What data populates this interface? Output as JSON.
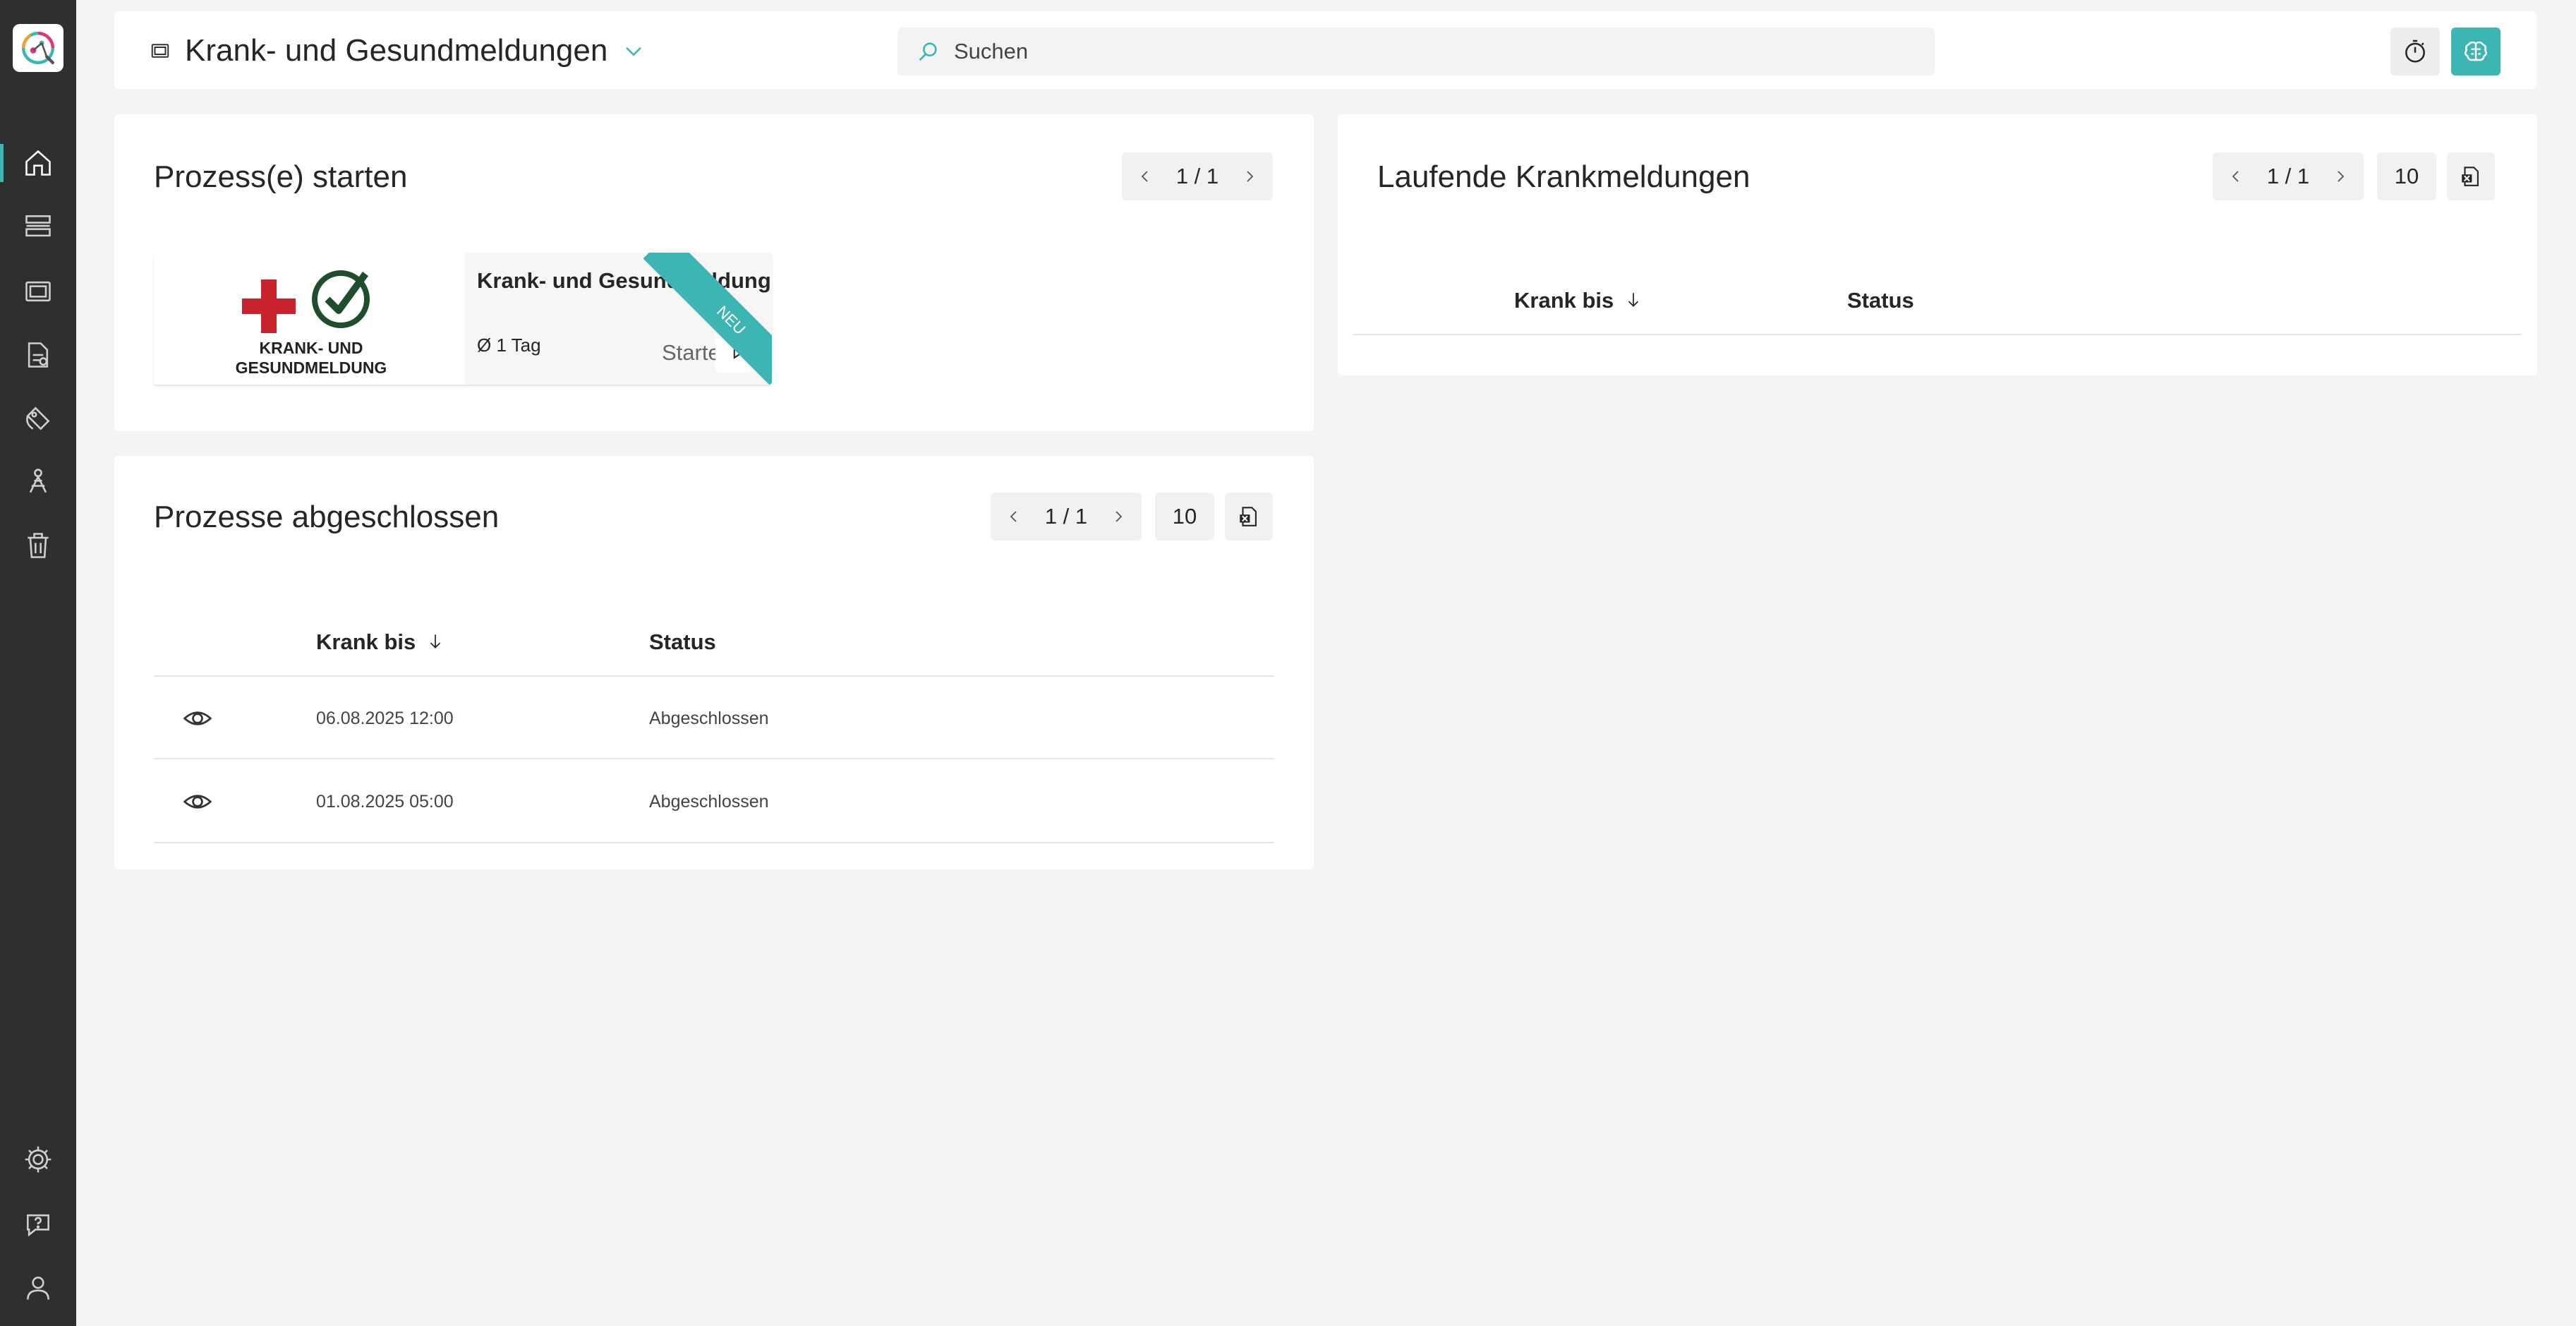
{
  "sidebar": {
    "items": [
      {
        "name": "home",
        "icon": "home-icon",
        "active": true
      },
      {
        "name": "processes",
        "icon": "process-list-icon"
      },
      {
        "name": "media",
        "icon": "media-icon"
      },
      {
        "name": "documents",
        "icon": "document-icon"
      },
      {
        "name": "tags",
        "icon": "tag-icon"
      },
      {
        "name": "network",
        "icon": "network-icon"
      },
      {
        "name": "trash",
        "icon": "trash-icon"
      }
    ],
    "bottom_items": [
      {
        "name": "settings",
        "icon": "gear-icon"
      },
      {
        "name": "help",
        "icon": "help-chat-icon"
      },
      {
        "name": "profile",
        "icon": "user-icon"
      }
    ]
  },
  "header": {
    "title": "Krank- und Gesundmeldungen",
    "search_placeholder": "Suchen"
  },
  "start_card": {
    "title": "Prozess(e) starten",
    "pager": "1 / 1",
    "process": {
      "name": "Krank- und Gesundmeldung",
      "image_text_1": "KRANK- UND",
      "image_text_2": "GESUNDMELDUNG",
      "duration": "Ø 1 Tag",
      "start_label": "Starten",
      "badge": "NEU"
    }
  },
  "completed_card": {
    "title": "Prozesse abgeschlossen",
    "pager": "1 / 1",
    "page_size": "10",
    "columns": [
      "Krank bis",
      "Status"
    ],
    "rows": [
      {
        "date": "06.08.2025 12:00",
        "status": "Abgeschlossen"
      },
      {
        "date": "01.08.2025 05:00",
        "status": "Abgeschlossen"
      }
    ]
  },
  "running_card": {
    "title": "Laufende Krankmeldungen",
    "pager": "1 / 1",
    "page_size": "10",
    "columns": [
      "Krank bis",
      "Status"
    ]
  },
  "colors": {
    "accent": "#3cb5b3",
    "sidebar": "#2f2f2f",
    "background": "#f4f4f4",
    "cross_red": "#c8232c",
    "check_green": "#1f4e2c"
  }
}
